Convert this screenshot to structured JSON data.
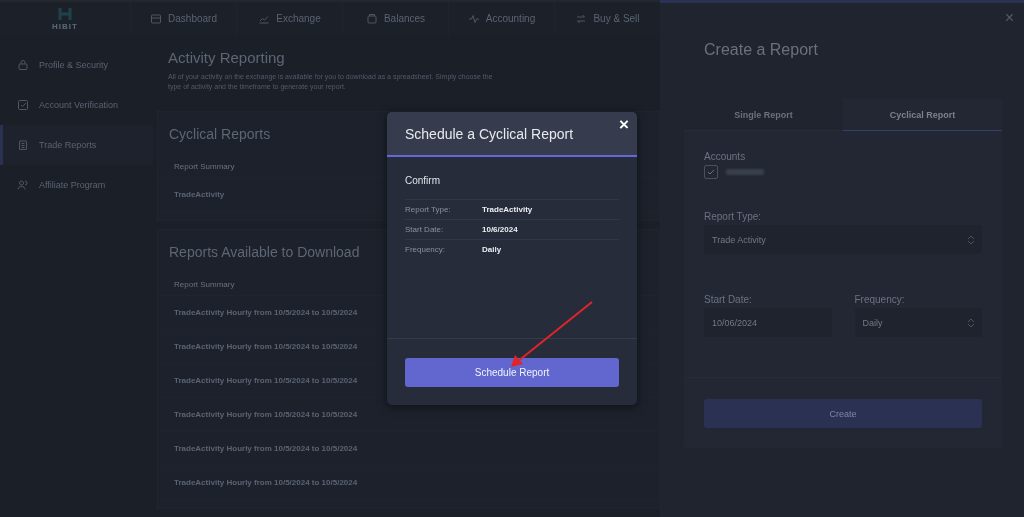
{
  "logo": {
    "text": "HIBIT"
  },
  "nav": [
    {
      "label": "Dashboard"
    },
    {
      "label": "Exchange"
    },
    {
      "label": "Balances"
    },
    {
      "label": "Accounting"
    },
    {
      "label": "Buy & Sell"
    }
  ],
  "sidebar": {
    "items": [
      {
        "label": "Profile & Security",
        "selected": false
      },
      {
        "label": "Account Verification",
        "selected": false
      },
      {
        "label": "Trade Reports",
        "selected": true
      },
      {
        "label": "Affiliate Program",
        "selected": false
      }
    ]
  },
  "page": {
    "title": "Activity Reporting",
    "intro": "All of your activity on the exchange is available for you to download as a spreadsheet. Simply choose the type of activity and the timeframe to generate your report."
  },
  "cyclical": {
    "title": "Cyclical Reports",
    "column": "Report Summary",
    "rows": [
      "TradeActivity"
    ]
  },
  "downloads": {
    "title": "Reports Available to Download",
    "column": "Report Summary",
    "rows": [
      "TradeActivity Hourly from 10/5/2024 to 10/5/2024",
      "TradeActivity Hourly from 10/5/2024 to 10/5/2024",
      "TradeActivity Hourly from 10/5/2024 to 10/5/2024",
      "TradeActivity Hourly from 10/5/2024 to 10/5/2024",
      "TradeActivity Hourly from 10/5/2024 to 10/5/2024",
      "TradeActivity Hourly from 10/5/2024 to 10/5/2024"
    ]
  },
  "drawer": {
    "title": "Create a Report",
    "close": "×",
    "tabs": [
      {
        "label": "Single Report",
        "selected": false
      },
      {
        "label": "Cyclical Report",
        "selected": true
      }
    ],
    "accounts_label": "Accounts",
    "account_checked": true,
    "report_type_label": "Report Type:",
    "report_type": "Trade Activity",
    "start_date_label": "Start Date:",
    "start_date": "10/06/2024",
    "frequency_label": "Frequency:",
    "frequency": "Daily",
    "create": "Create"
  },
  "modal": {
    "title": "Schedule a Cyclical Report",
    "close": "×",
    "subtitle": "Confirm",
    "details": [
      {
        "label": "Report Type:",
        "value": "TradeActivity"
      },
      {
        "label": "Start Date:",
        "value": "10/6/2024"
      },
      {
        "label": "Frequency:",
        "value": "Daily"
      }
    ],
    "button": "Schedule Report"
  }
}
